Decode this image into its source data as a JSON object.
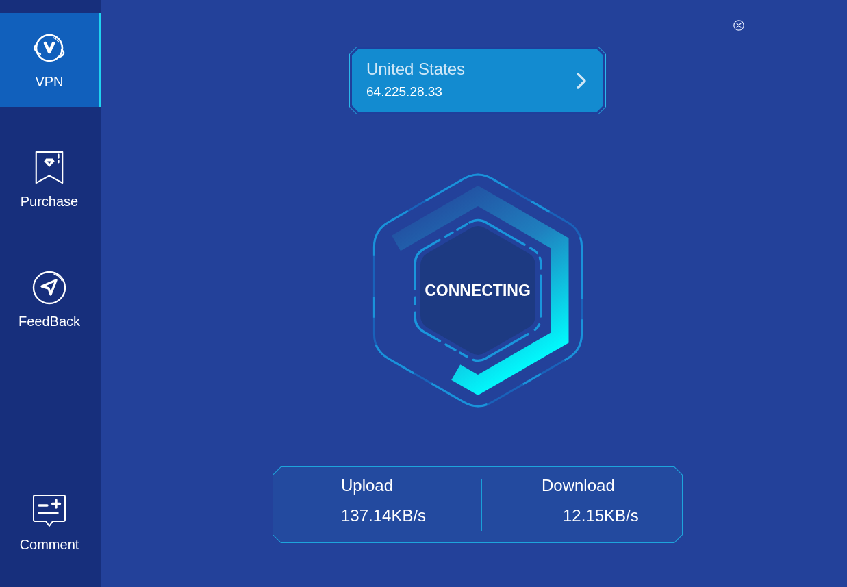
{
  "sidebar": {
    "items": [
      {
        "label": "VPN",
        "kind": "vpn",
        "selected": true
      },
      {
        "label": "Purchase",
        "kind": "purchase",
        "selected": false
      },
      {
        "label": "FeedBack",
        "kind": "feedback",
        "selected": false
      },
      {
        "label": "Comment",
        "kind": "comment",
        "selected": false
      }
    ]
  },
  "location": {
    "country": "United States",
    "ip": "64.225.28.33"
  },
  "status": {
    "label": "CONNECTING"
  },
  "traffic": [
    {
      "label": "Upload",
      "value": "137.14KB/s"
    },
    {
      "label": "Download",
      "value": "12.15KB/s"
    }
  ]
}
